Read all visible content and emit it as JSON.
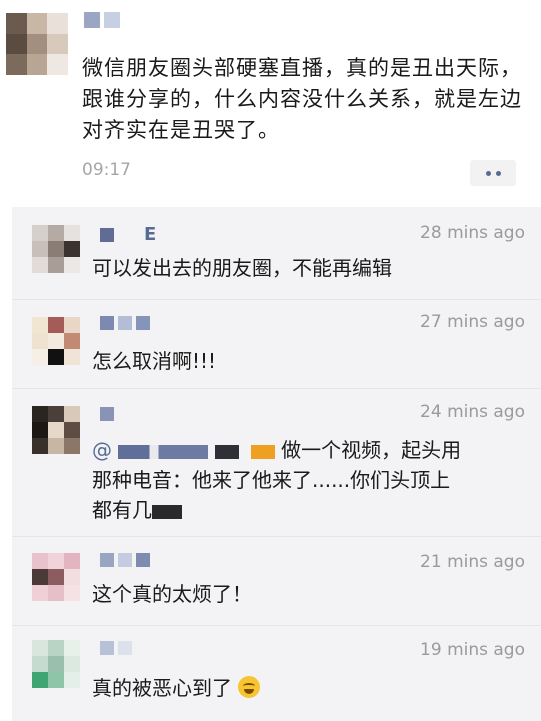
{
  "post": {
    "text": "微信朋友圈头部硬塞直播，真的是丑出天际，跟谁分享的，什么内容没什么关系，就是左边对齐实在是丑哭了。",
    "time": "09:17",
    "more_icon": "more-dots-icon"
  },
  "comments": [
    {
      "name_suffix": "E",
      "time": "28 mins ago",
      "text": "可以发出去的朋友圈，不能再编辑"
    },
    {
      "name_suffix": "",
      "time": "27 mins ago",
      "text": "怎么取消啊!!!"
    },
    {
      "name_suffix": "",
      "time": "24 mins ago",
      "mention_prefix": "@",
      "text_line1_tail": "做一个视频，起头用",
      "text_line2": "那种电音：他来了他来了......你们头顶上",
      "text_line3": "都有几",
      "text": ""
    },
    {
      "name_suffix": "",
      "time": "21 mins ago",
      "text": "这个真的太烦了！"
    },
    {
      "name_suffix": "",
      "time": "19 mins ago",
      "text": "真的被恶心到了",
      "emoji_icon": "laughing-crying-emoji-icon"
    }
  ],
  "colors": {
    "link": "#576b95",
    "time": "#9a9a9a",
    "comment_bg": "#f3f3f5"
  }
}
